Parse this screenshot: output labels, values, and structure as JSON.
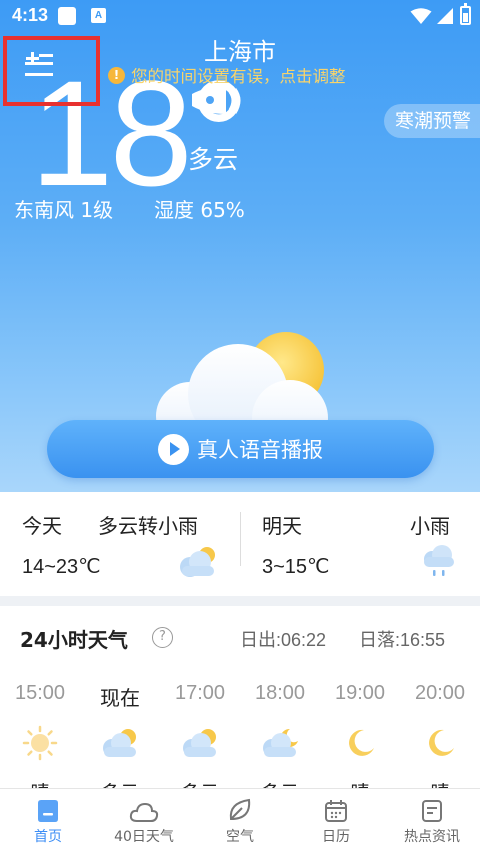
{
  "status_bar": {
    "time": "4:13",
    "a_label": "A"
  },
  "header": {
    "city": "上海市",
    "notice_icon": "!",
    "notice": "您的时间设置有误，点击调整"
  },
  "current": {
    "temperature": "18°",
    "condition": "多云",
    "warning": "寒潮预警",
    "wind": "东南风 1级",
    "humidity": "湿度 65%"
  },
  "voice_button": {
    "label": "真人语音播报"
  },
  "forecast": {
    "today": {
      "day": "今天",
      "condition": "多云转小雨",
      "temp": "14~23℃",
      "icon": "partly-cloudy-icon"
    },
    "tomorrow": {
      "day": "明天",
      "condition": "小雨",
      "temp": "3~15℃",
      "icon": "light-rain-icon"
    }
  },
  "hourly": {
    "title": "24小时天气",
    "help": "?",
    "sunrise": "日出:06:22",
    "sunset": "日落:16:55",
    "hours": [
      {
        "time": "15:00",
        "condition": "晴",
        "icon": "sun-icon"
      },
      {
        "time": "现在",
        "condition": "多云",
        "icon": "partly-cloudy-icon"
      },
      {
        "time": "17:00",
        "condition": "多云",
        "icon": "partly-cloudy-icon"
      },
      {
        "time": "18:00",
        "condition": "多云",
        "icon": "partly-cloudy-night-icon"
      },
      {
        "time": "19:00",
        "condition": "晴",
        "icon": "moon-icon"
      },
      {
        "time": "20:00",
        "condition": "晴",
        "icon": "moon-icon"
      }
    ]
  },
  "tabs": [
    {
      "label": "首页",
      "icon": "home-icon",
      "active": true
    },
    {
      "label": "40日天气",
      "icon": "cloud-icon",
      "active": false
    },
    {
      "label": "空气",
      "icon": "leaf-icon",
      "active": false
    },
    {
      "label": "日历",
      "icon": "calendar-icon",
      "active": false
    },
    {
      "label": "热点资讯",
      "icon": "news-icon",
      "active": false
    }
  ],
  "colors": {
    "accent": "#3d8ef5",
    "notice": "#f8d46b",
    "alert_border": "#e8312f"
  }
}
